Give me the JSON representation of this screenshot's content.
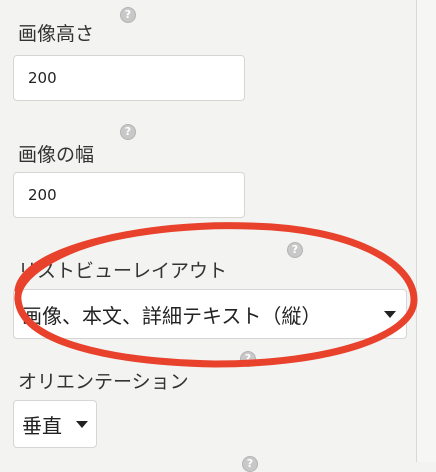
{
  "help_glyph": "?",
  "fields": {
    "image_height": {
      "label": "画像高さ",
      "value": "200"
    },
    "image_width": {
      "label": "画像の幅",
      "value": "200"
    },
    "list_view_layout": {
      "label": "リストビューレイアウト",
      "value": "画像、本文、詳細テキスト（縦）"
    },
    "orientation": {
      "label": "オリエンテーション",
      "value": "垂直"
    }
  },
  "annotation": {
    "color": "#e8412c",
    "shape": "ellipse"
  },
  "icons": {
    "help": "question-circle-icon",
    "dropdown": "caret-down-icon"
  }
}
